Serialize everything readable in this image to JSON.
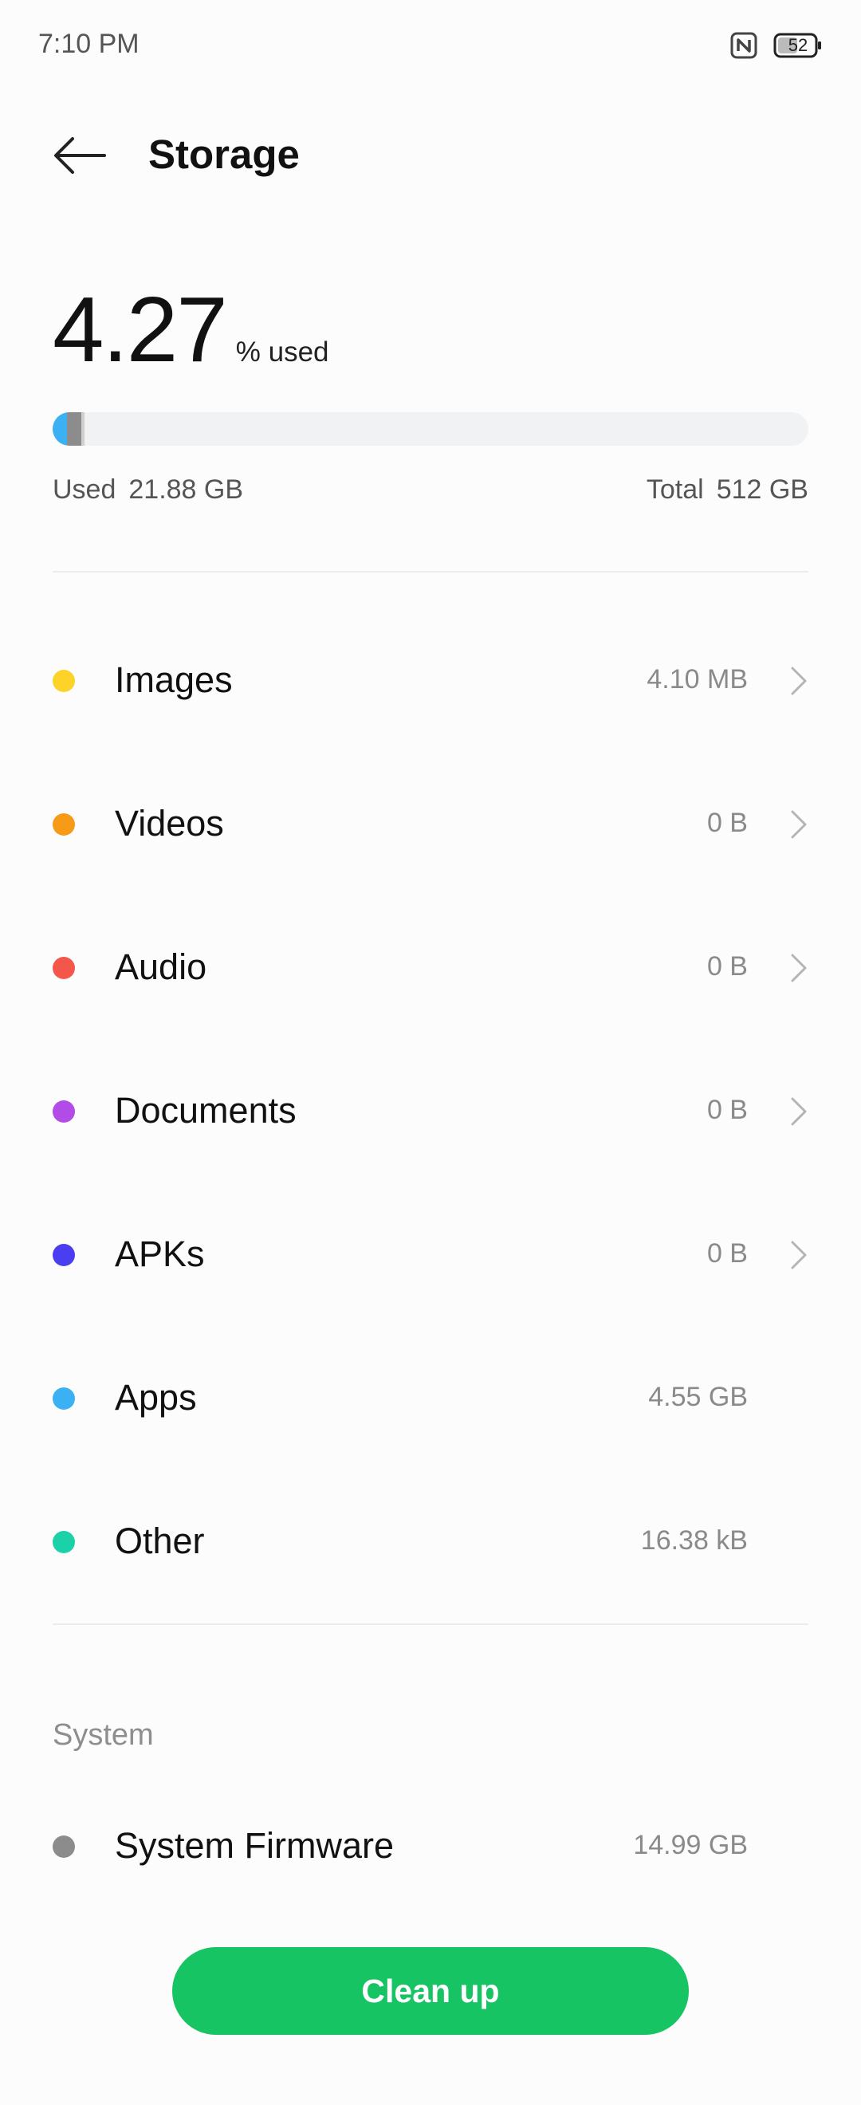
{
  "status_bar": {
    "time": "7:10 PM",
    "battery_level": "52",
    "icons": [
      "nfc-icon",
      "battery-icon"
    ]
  },
  "header": {
    "title": "Storage",
    "back_icon": "arrow-left-icon"
  },
  "usage": {
    "percent": "4.27",
    "percent_suffix": "% used",
    "used_label": "Used",
    "used_value": "21.88 GB",
    "total_label": "Total",
    "total_value": "512 GB",
    "fill_fraction": 0.0427
  },
  "categories": [
    {
      "label": "Images",
      "size": "4.10 MB",
      "color": "#fdd32a",
      "has_chevron": true
    },
    {
      "label": "Videos",
      "size": "0 B",
      "color": "#f79a17",
      "has_chevron": true
    },
    {
      "label": "Audio",
      "size": "0 B",
      "color": "#f4564a",
      "has_chevron": true
    },
    {
      "label": "Documents",
      "size": "0 B",
      "color": "#b24ce8",
      "has_chevron": true
    },
    {
      "label": "APKs",
      "size": "0 B",
      "color": "#4b3ef0",
      "has_chevron": true
    },
    {
      "label": "Apps",
      "size": "4.55 GB",
      "color": "#3bb0f2",
      "has_chevron": false
    },
    {
      "label": "Other",
      "size": "16.38 kB",
      "color": "#1bd1a8",
      "has_chevron": false
    }
  ],
  "system": {
    "section_title": "System",
    "firmware_label": "System Firmware",
    "firmware_size": "14.99 GB",
    "firmware_color": "#8c8c8c"
  },
  "actions": {
    "clean_up_label": "Clean up",
    "clean_up_color": "#17c464"
  }
}
